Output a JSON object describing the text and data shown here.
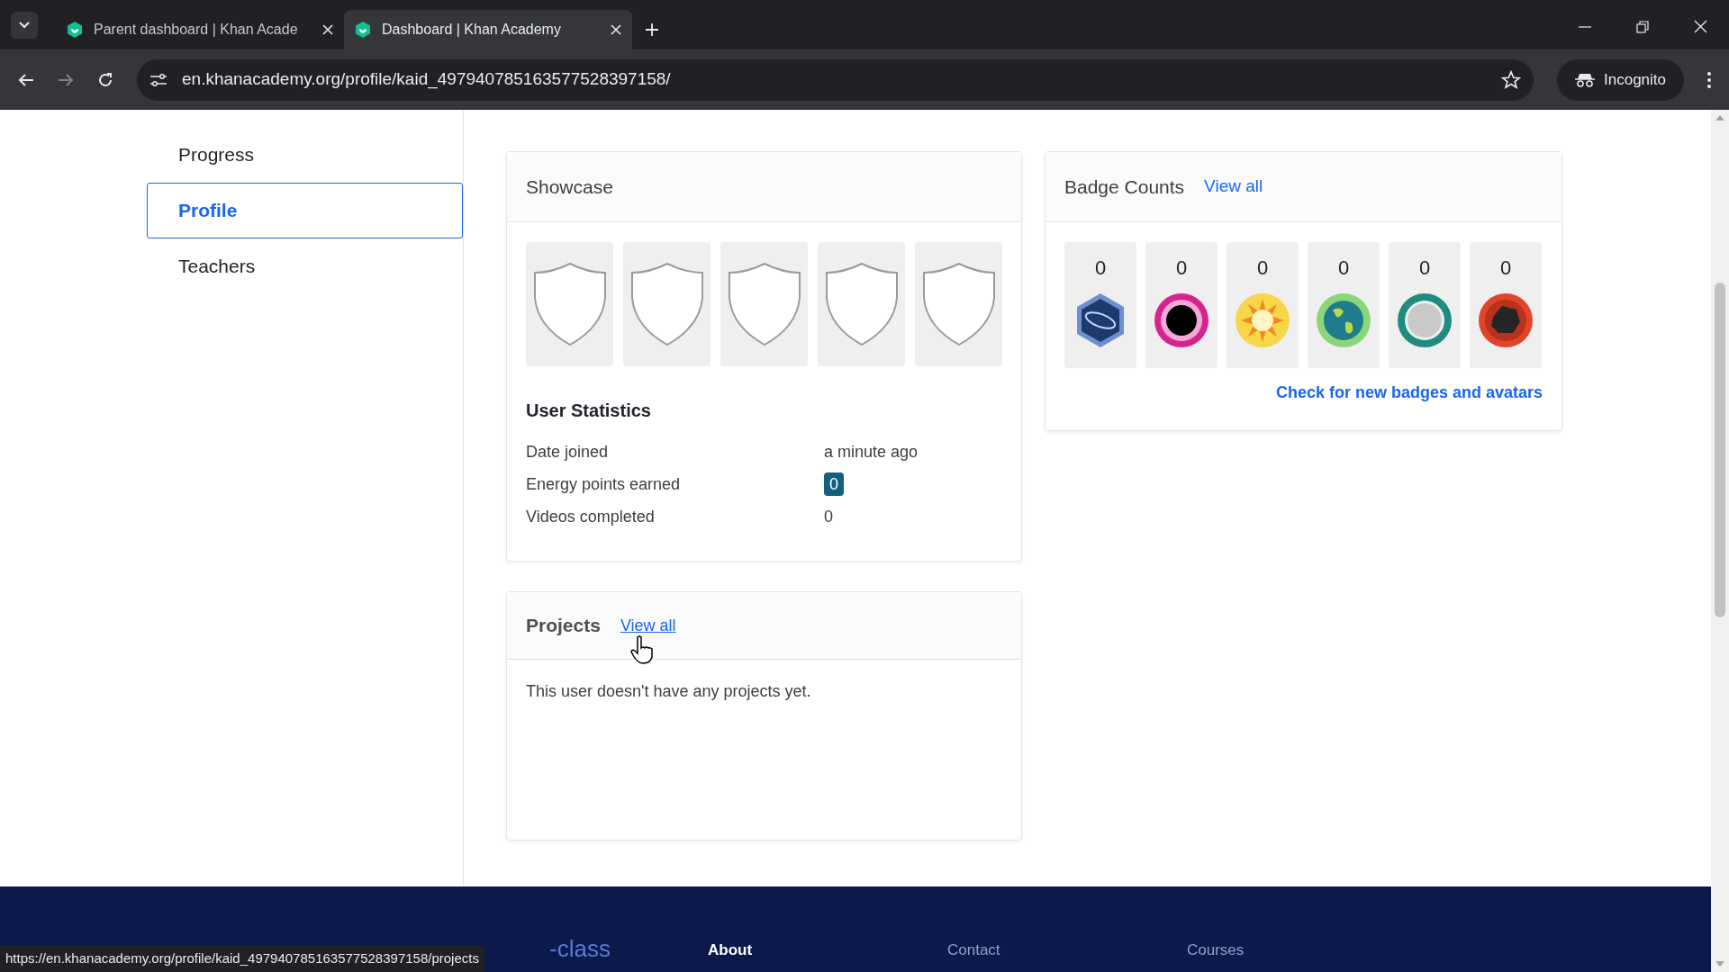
{
  "browser": {
    "tabs": [
      {
        "title": "Parent dashboard | Khan Acade",
        "selected": false
      },
      {
        "title": "Dashboard | Khan Academy",
        "selected": true
      }
    ],
    "url": "en.khanacademy.org/profile/kaid_497940785163577528397158/",
    "mode": "Incognito"
  },
  "sidebar": {
    "items": [
      {
        "label": "Progress",
        "selected": false
      },
      {
        "label": "Profile",
        "selected": true
      },
      {
        "label": "Teachers",
        "selected": false
      }
    ]
  },
  "showcase": {
    "title": "Showcase",
    "slots": [
      {
        "kind": "empty"
      },
      {
        "kind": "empty"
      },
      {
        "kind": "empty"
      },
      {
        "kind": "empty"
      },
      {
        "kind": "empty"
      }
    ]
  },
  "statistics": {
    "title": "User Statistics",
    "rows": [
      {
        "label": "Date joined",
        "value": "a minute ago",
        "kind": "plain"
      },
      {
        "label": "Energy points earned",
        "value": "0",
        "kind": "pill"
      },
      {
        "label": "Videos completed",
        "value": "0",
        "kind": "plain"
      }
    ]
  },
  "badges": {
    "title": "Badge Counts",
    "link": "View all",
    "counts": [
      "0",
      "0",
      "0",
      "0",
      "0",
      "0"
    ],
    "footer_link": "Check for new badges and avatars"
  },
  "projects": {
    "title": "Projects",
    "link": "View all",
    "empty_text": "This user doesn't have any projects yet."
  },
  "footer": {
    "fragment": "-class",
    "columns": [
      {
        "label": "About",
        "selected": true
      },
      {
        "label": "Contact",
        "selected": false
      },
      {
        "label": "Courses",
        "selected": false
      }
    ]
  },
  "status_url": "https://en.khanacademy.org/profile/kaid_497940785163577528397158/projects"
}
